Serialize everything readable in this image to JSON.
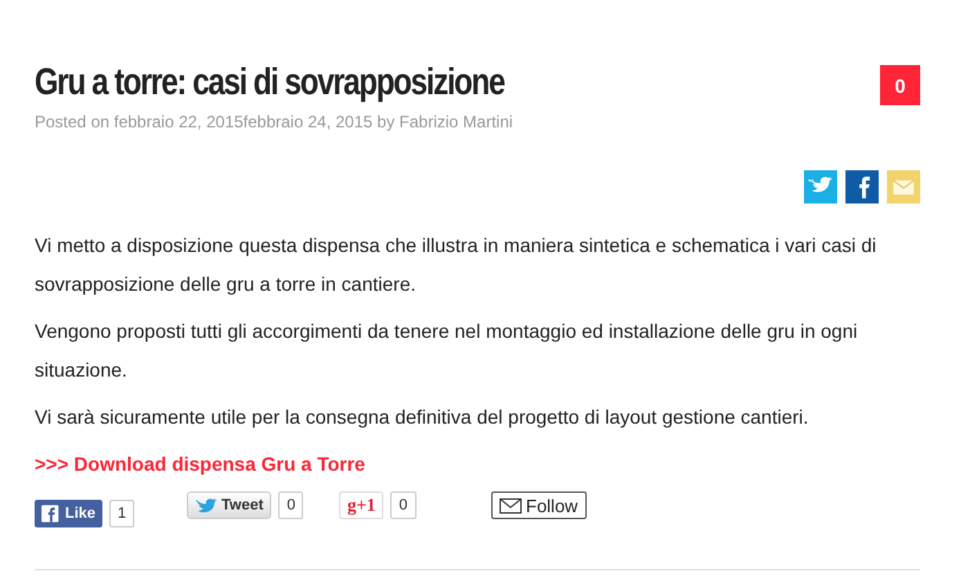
{
  "post": {
    "title": "Gru a torre: casi di sovrapposizione",
    "comment_count": "0",
    "meta": "Posted on febbraio 22, 2015febbraio 24, 2015 by Fabrizio Martini"
  },
  "share_icons": [
    {
      "kind": "twitter"
    },
    {
      "kind": "facebook"
    },
    {
      "kind": "email"
    }
  ],
  "paragraphs": [
    "Vi metto a disposizione questa dispensa che illustra in maniera sintetica e schematica i vari casi di sovrapposizione delle gru a torre in cantiere.",
    "Vengono proposti tutti gli accorgimenti da tenere nel montaggio ed installazione delle gru in ogni situazione.",
    "Vi sarà sicuramente utile per la consegna definitiva del progetto di layout gestione cantieri."
  ],
  "download_link": ">>> Download dispensa Gru a Torre",
  "social_buttons": [
    {
      "kind": "facebook",
      "label": "Like",
      "count": "1"
    },
    {
      "kind": "twitter",
      "label": "Tweet",
      "count": "0"
    },
    {
      "kind": "gplus",
      "label": "g+1",
      "count": "0"
    },
    {
      "kind": "follow",
      "label": "Follow"
    }
  ]
}
